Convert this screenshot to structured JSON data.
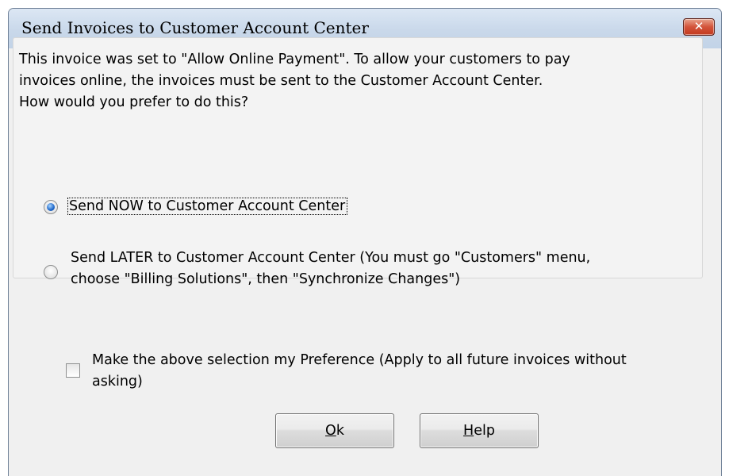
{
  "window": {
    "title": "Send Invoices to Customer Account Center",
    "close_glyph": "✕"
  },
  "message": {
    "line1": "This invoice was set to \"Allow Online Payment\".  To allow your customers to pay",
    "line2": "invoices online, the invoices must be sent to the Customer Account Center.",
    "line3": "How would you prefer to do this?"
  },
  "options": {
    "send_now": {
      "label": "Send NOW to Customer Account Center",
      "selected": true
    },
    "send_later": {
      "line1": "Send LATER to Customer Account Center (You must go \"Customers\" menu,",
      "line2": "choose \"Billing Solutions\", then \"Synchronize Changes\")",
      "selected": false
    }
  },
  "preference": {
    "line1": "Make the above selection my Preference (Apply to all future invoices without",
    "line2": "asking)",
    "checked": false
  },
  "buttons": {
    "ok": {
      "mnemonic": "O",
      "rest": "k"
    },
    "help": {
      "mnemonic": "H",
      "rest": "elp"
    }
  },
  "colors": {
    "close_button": "#d3533a",
    "radio_selected": "#1d66c9"
  }
}
